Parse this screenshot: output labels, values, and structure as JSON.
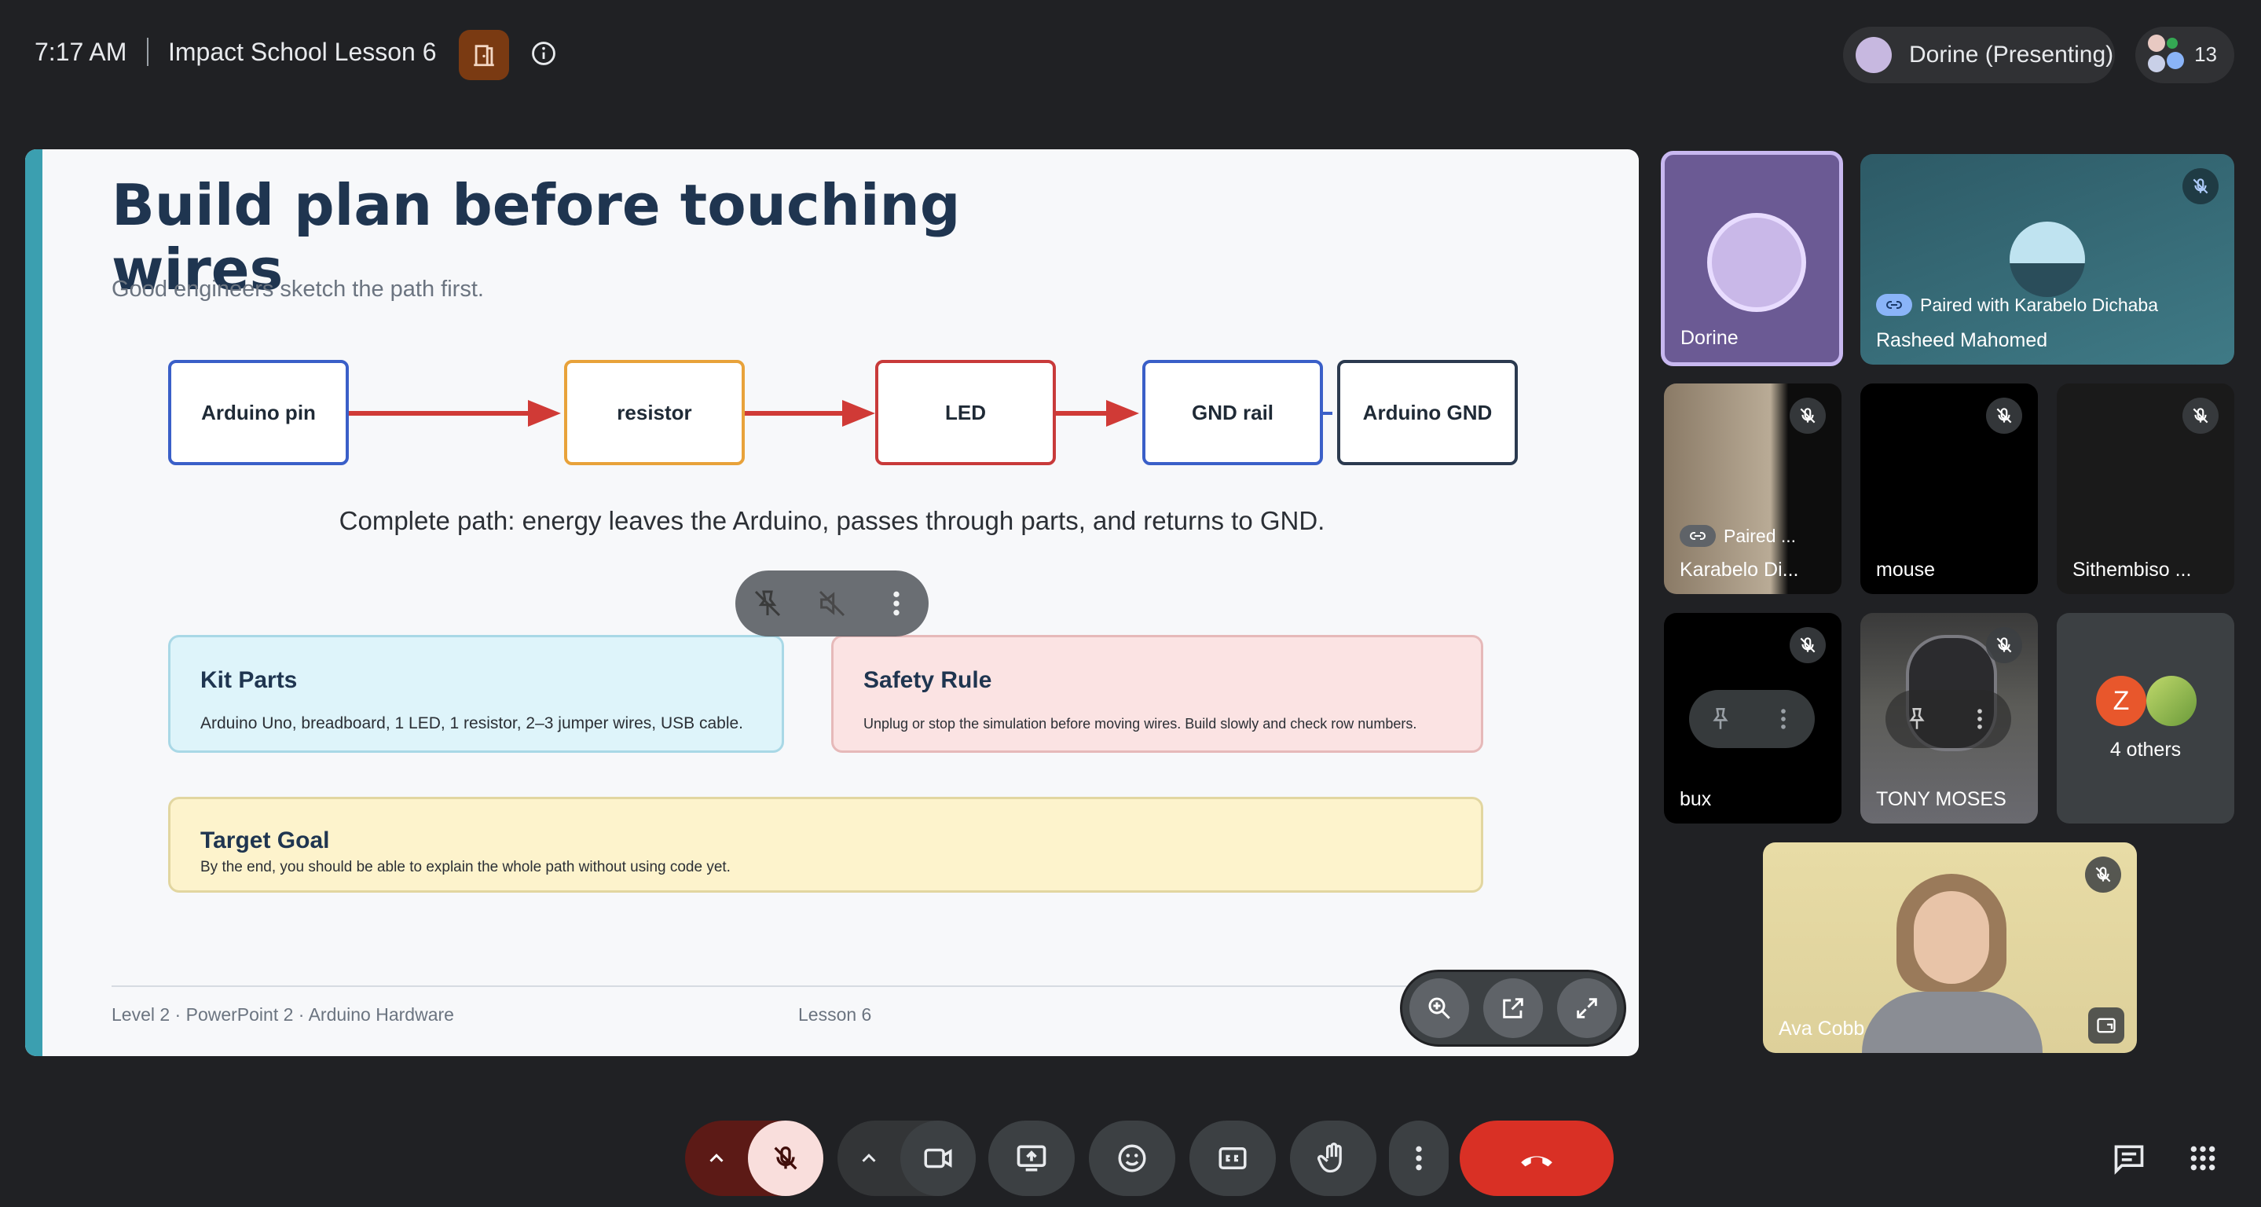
{
  "topbar": {
    "time": "7:17 AM",
    "meeting_title": "Impact School Lesson 6",
    "breakout_icon": "door-icon",
    "info_icon": "info-icon",
    "presenter_label": "Dorine (Presenting)",
    "participant_count": "13"
  },
  "slide": {
    "title": "Build plan before touching wires",
    "subtitle": "Good engineers sketch the path first.",
    "flow": [
      {
        "label": "Arduino pin",
        "color": "#3a5fc8"
      },
      {
        "label": "resistor",
        "color": "#e8a23a"
      },
      {
        "label": "LED",
        "color": "#c83a3a"
      },
      {
        "label": "GND rail",
        "color": "#3a5fc8"
      },
      {
        "label": "Arduino GND",
        "color": "#2b3a4f"
      }
    ],
    "flow_caption": "Complete path: energy leaves the Arduino, passes through parts, and returns to GND.",
    "cards": {
      "kit": {
        "title": "Kit Parts",
        "text": "Arduino Uno, breadboard, 1 LED, 1 resistor, 2–3 jumper wires, USB cable."
      },
      "safety": {
        "title": "Safety Rule",
        "text": "Unplug or stop the simulation before moving wires. Build slowly and check row numbers."
      },
      "goal": {
        "title": "Target Goal",
        "text": "By the end, you should be able to explain the whole path without using code yet."
      }
    },
    "footer_left": "Level 2 · PowerPoint 2 · Arduino Hardware",
    "footer_center": "Lesson 6"
  },
  "participants": {
    "dorine": {
      "name": "Dorine"
    },
    "rasheed": {
      "name": "Rasheed Mahomed",
      "paired": "Paired with Karabelo Dichaba"
    },
    "karabelo": {
      "name": "Karabelo Di...",
      "paired": "Paired ..."
    },
    "mouse": {
      "name": "mouse"
    },
    "sithembiso": {
      "name": "Sithembiso ..."
    },
    "bux": {
      "name": "bux"
    },
    "tony": {
      "name": "TONY MOSES"
    },
    "others": {
      "label": "4 others",
      "avatar_letter": "Z"
    },
    "ava": {
      "name": "Ava Cobb"
    }
  },
  "colors": {
    "end_call": "#d93025",
    "mic_off_bg": "#f9dedc",
    "accent_bar": "#3b9fb0",
    "presenter_tile": "#6b5a94"
  }
}
